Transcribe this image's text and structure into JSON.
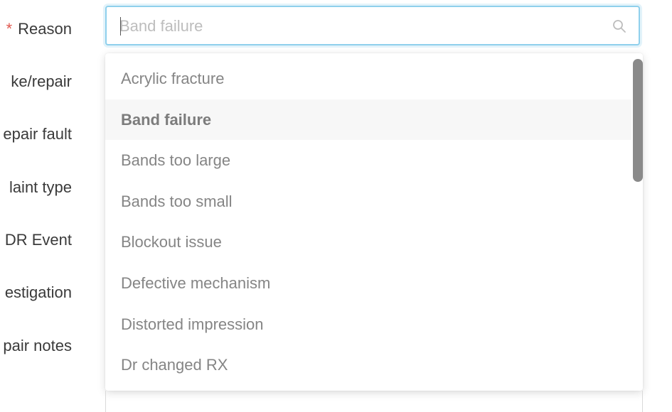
{
  "form": {
    "labels": {
      "reason": "Reason",
      "remake_repair": "ke/repair",
      "repair_fault": "epair fault",
      "complaint_type": "laint type",
      "dr_event": "DR Event",
      "investigation": "estigation",
      "repair_notes": "pair notes"
    },
    "required_marker": "*",
    "colors": {
      "required": "#e0584f",
      "focus_border": "#8fd0ec"
    }
  },
  "search": {
    "placeholder": "Band failure",
    "value": "",
    "icon": "search-icon"
  },
  "dropdown": {
    "options": [
      {
        "label": "Acrylic fracture"
      },
      {
        "label": "Band failure"
      },
      {
        "label": "Bands too large"
      },
      {
        "label": "Bands too small"
      },
      {
        "label": "Blockout issue"
      },
      {
        "label": "Defective mechanism"
      },
      {
        "label": "Distorted impression"
      },
      {
        "label": "Dr changed RX"
      }
    ],
    "selected_label": "Band failure"
  }
}
